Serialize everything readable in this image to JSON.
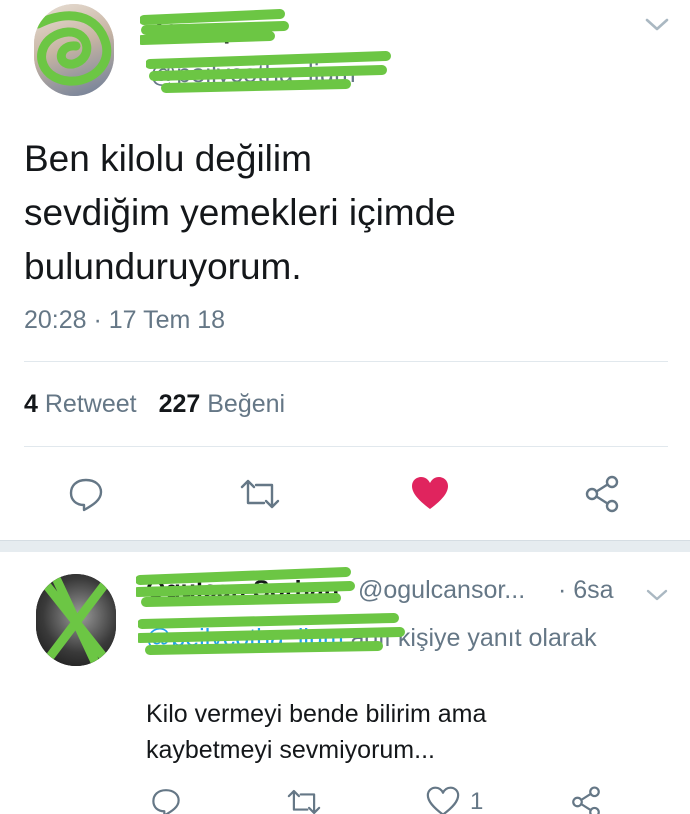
{
  "tweet": {
    "author_name": "Zeynep",
    "author_handle": "@peilycotha_lium",
    "text_lines": [
      "Ben kilolu değilim",
      "sevdiğim yemekleri içimde",
      "bulunduruyorum."
    ],
    "timestamp": "20:28 · 17 Tem 18",
    "retweet_count": "4",
    "retweet_label": "Retweet",
    "like_count": "227",
    "like_label": "Beğeni"
  },
  "reply": {
    "author_name": "Oğulcan Sorhan",
    "author_handle": "@ogulcansor...",
    "time": "· 6sa",
    "reply_to_mention": "@peilycotha_lium",
    "reply_to_suffix": " adlı kişiye yanıt olarak",
    "text_lines": [
      "Kilo vermeyi bende bilirim ama",
      "kaybetmeyi sevmiyorum..."
    ],
    "like_count": "1"
  },
  "colors": {
    "text_primary": "#14171a",
    "text_secondary": "#657786",
    "link_blue": "#1da1f2",
    "like_red": "#e0245e",
    "censor_green": "#6cc644",
    "separator": "#e6ecf0"
  },
  "icons": [
    "chevron-down-icon",
    "reply-icon",
    "retweet-icon",
    "heart-icon",
    "share-icon"
  ]
}
